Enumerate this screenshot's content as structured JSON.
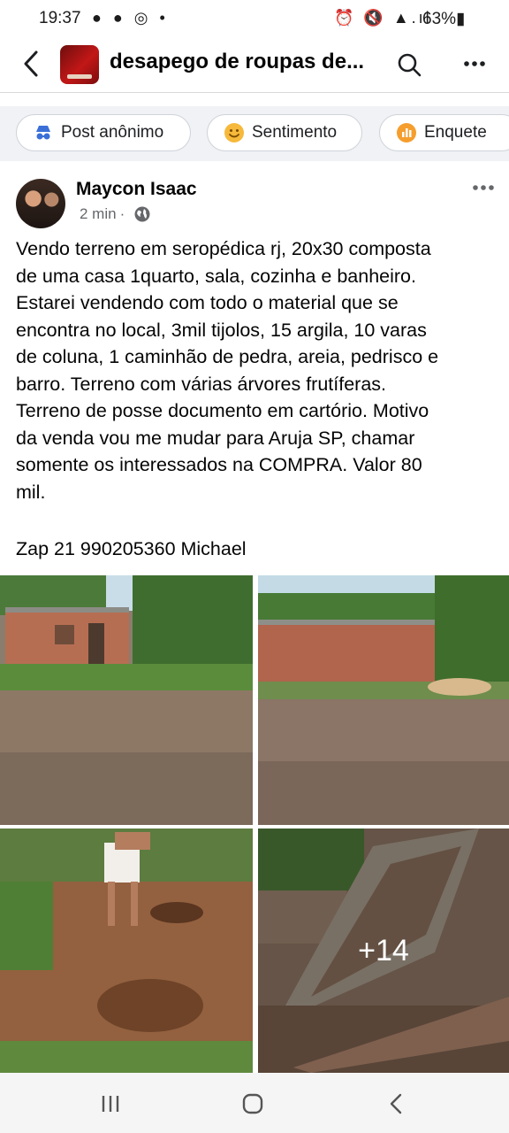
{
  "status_bar": {
    "time": "19:37",
    "left_icons": "● ● ◎ •",
    "right_icons": "⏰ 🔇 ▲.ıl",
    "battery": "63%▮"
  },
  "header": {
    "group_title": "desapego de roupas de..."
  },
  "chips": [
    {
      "label": "Post anônimo",
      "icon": "incognito-icon",
      "color": "#3b6fd8"
    },
    {
      "label": "Sentimento",
      "icon": "smiley-icon",
      "color": "#f6b93b"
    },
    {
      "label": "Enquete",
      "icon": "poll-icon",
      "color": "#f59e2e"
    }
  ],
  "post": {
    "author": "Maycon Isaac",
    "time": "2 min",
    "separator": "·",
    "text": "Vendo terreno em seropédica rj, 20x30 composta\nde uma casa 1quarto, sala, cozinha e banheiro.\nEstarei vendendo com todo o material que se\nencontra no local, 3mil tijolos, 15 argila, 10 varas\nde coluna, 1 caminhão de pedra, areia, pedrisco e\nbarro. Terreno com várias árvores frutíferas.\nTerreno de posse documento em cartório. Motivo\nda venda vou me mudar para Aruja SP, chamar\nsomente os interessados na COMPRA. Valor 80\nmil.",
    "phone_line": "Zap 21 990205360 Michael",
    "more_photos": "+14"
  },
  "colors": {
    "accent": "#1877f2",
    "secondary_text": "#65676b",
    "chip_bar_bg": "#f0f2f5"
  }
}
